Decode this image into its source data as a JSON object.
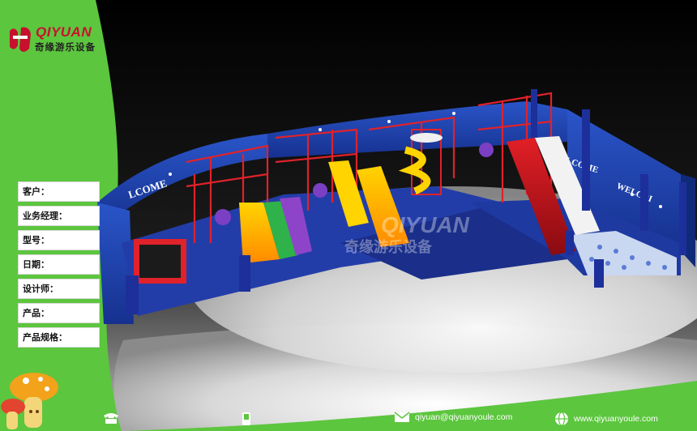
{
  "brand": {
    "name": "QIYUAN",
    "subtitle": "奇缘游乐设备"
  },
  "form_fields": [
    {
      "label": "客户："
    },
    {
      "label": "业务经理："
    },
    {
      "label": "型号："
    },
    {
      "label": "日期："
    },
    {
      "label": "设计师："
    },
    {
      "label": "产品："
    },
    {
      "label": "产品规格："
    }
  ],
  "render": {
    "sign_left": "LCOME",
    "sign_mid": "WELCOME",
    "sign_right": "WELCOI",
    "watermark_en": "QIYUAN",
    "watermark_cn": "奇缘游乐设备"
  },
  "footer": {
    "email": "qiyuan@qiyuanyoule.com",
    "website": "www.qiyuanyoule.com",
    "icons": [
      "phone-icon",
      "mobile-icon",
      "email-icon",
      "globe-icon"
    ]
  },
  "colors": {
    "green": "#5cc63e",
    "red": "#c8102e",
    "wall_blue": "#1d3fb0"
  }
}
